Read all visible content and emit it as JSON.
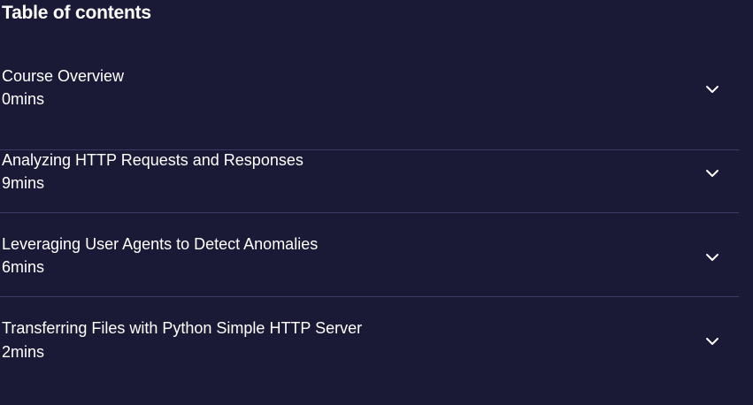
{
  "toc": {
    "title": "Table of contents",
    "modules": [
      {
        "title": "Course Overview",
        "duration": "0mins",
        "icon": "chevron-down-icon"
      },
      {
        "title": "Analyzing HTTP Requests and Responses",
        "duration": "9mins",
        "icon": "chevron-down-icon"
      },
      {
        "title": "Leveraging User Agents to Detect Anomalies",
        "duration": "6mins",
        "icon": "chevron-down-icon"
      },
      {
        "title": "Transferring Files with Python Simple HTTP Server",
        "duration": "2mins",
        "icon": "chevron-down-icon"
      }
    ]
  },
  "colors": {
    "background": "#1b1a36",
    "text": "#ffffff",
    "divider": "#3f3b66"
  }
}
